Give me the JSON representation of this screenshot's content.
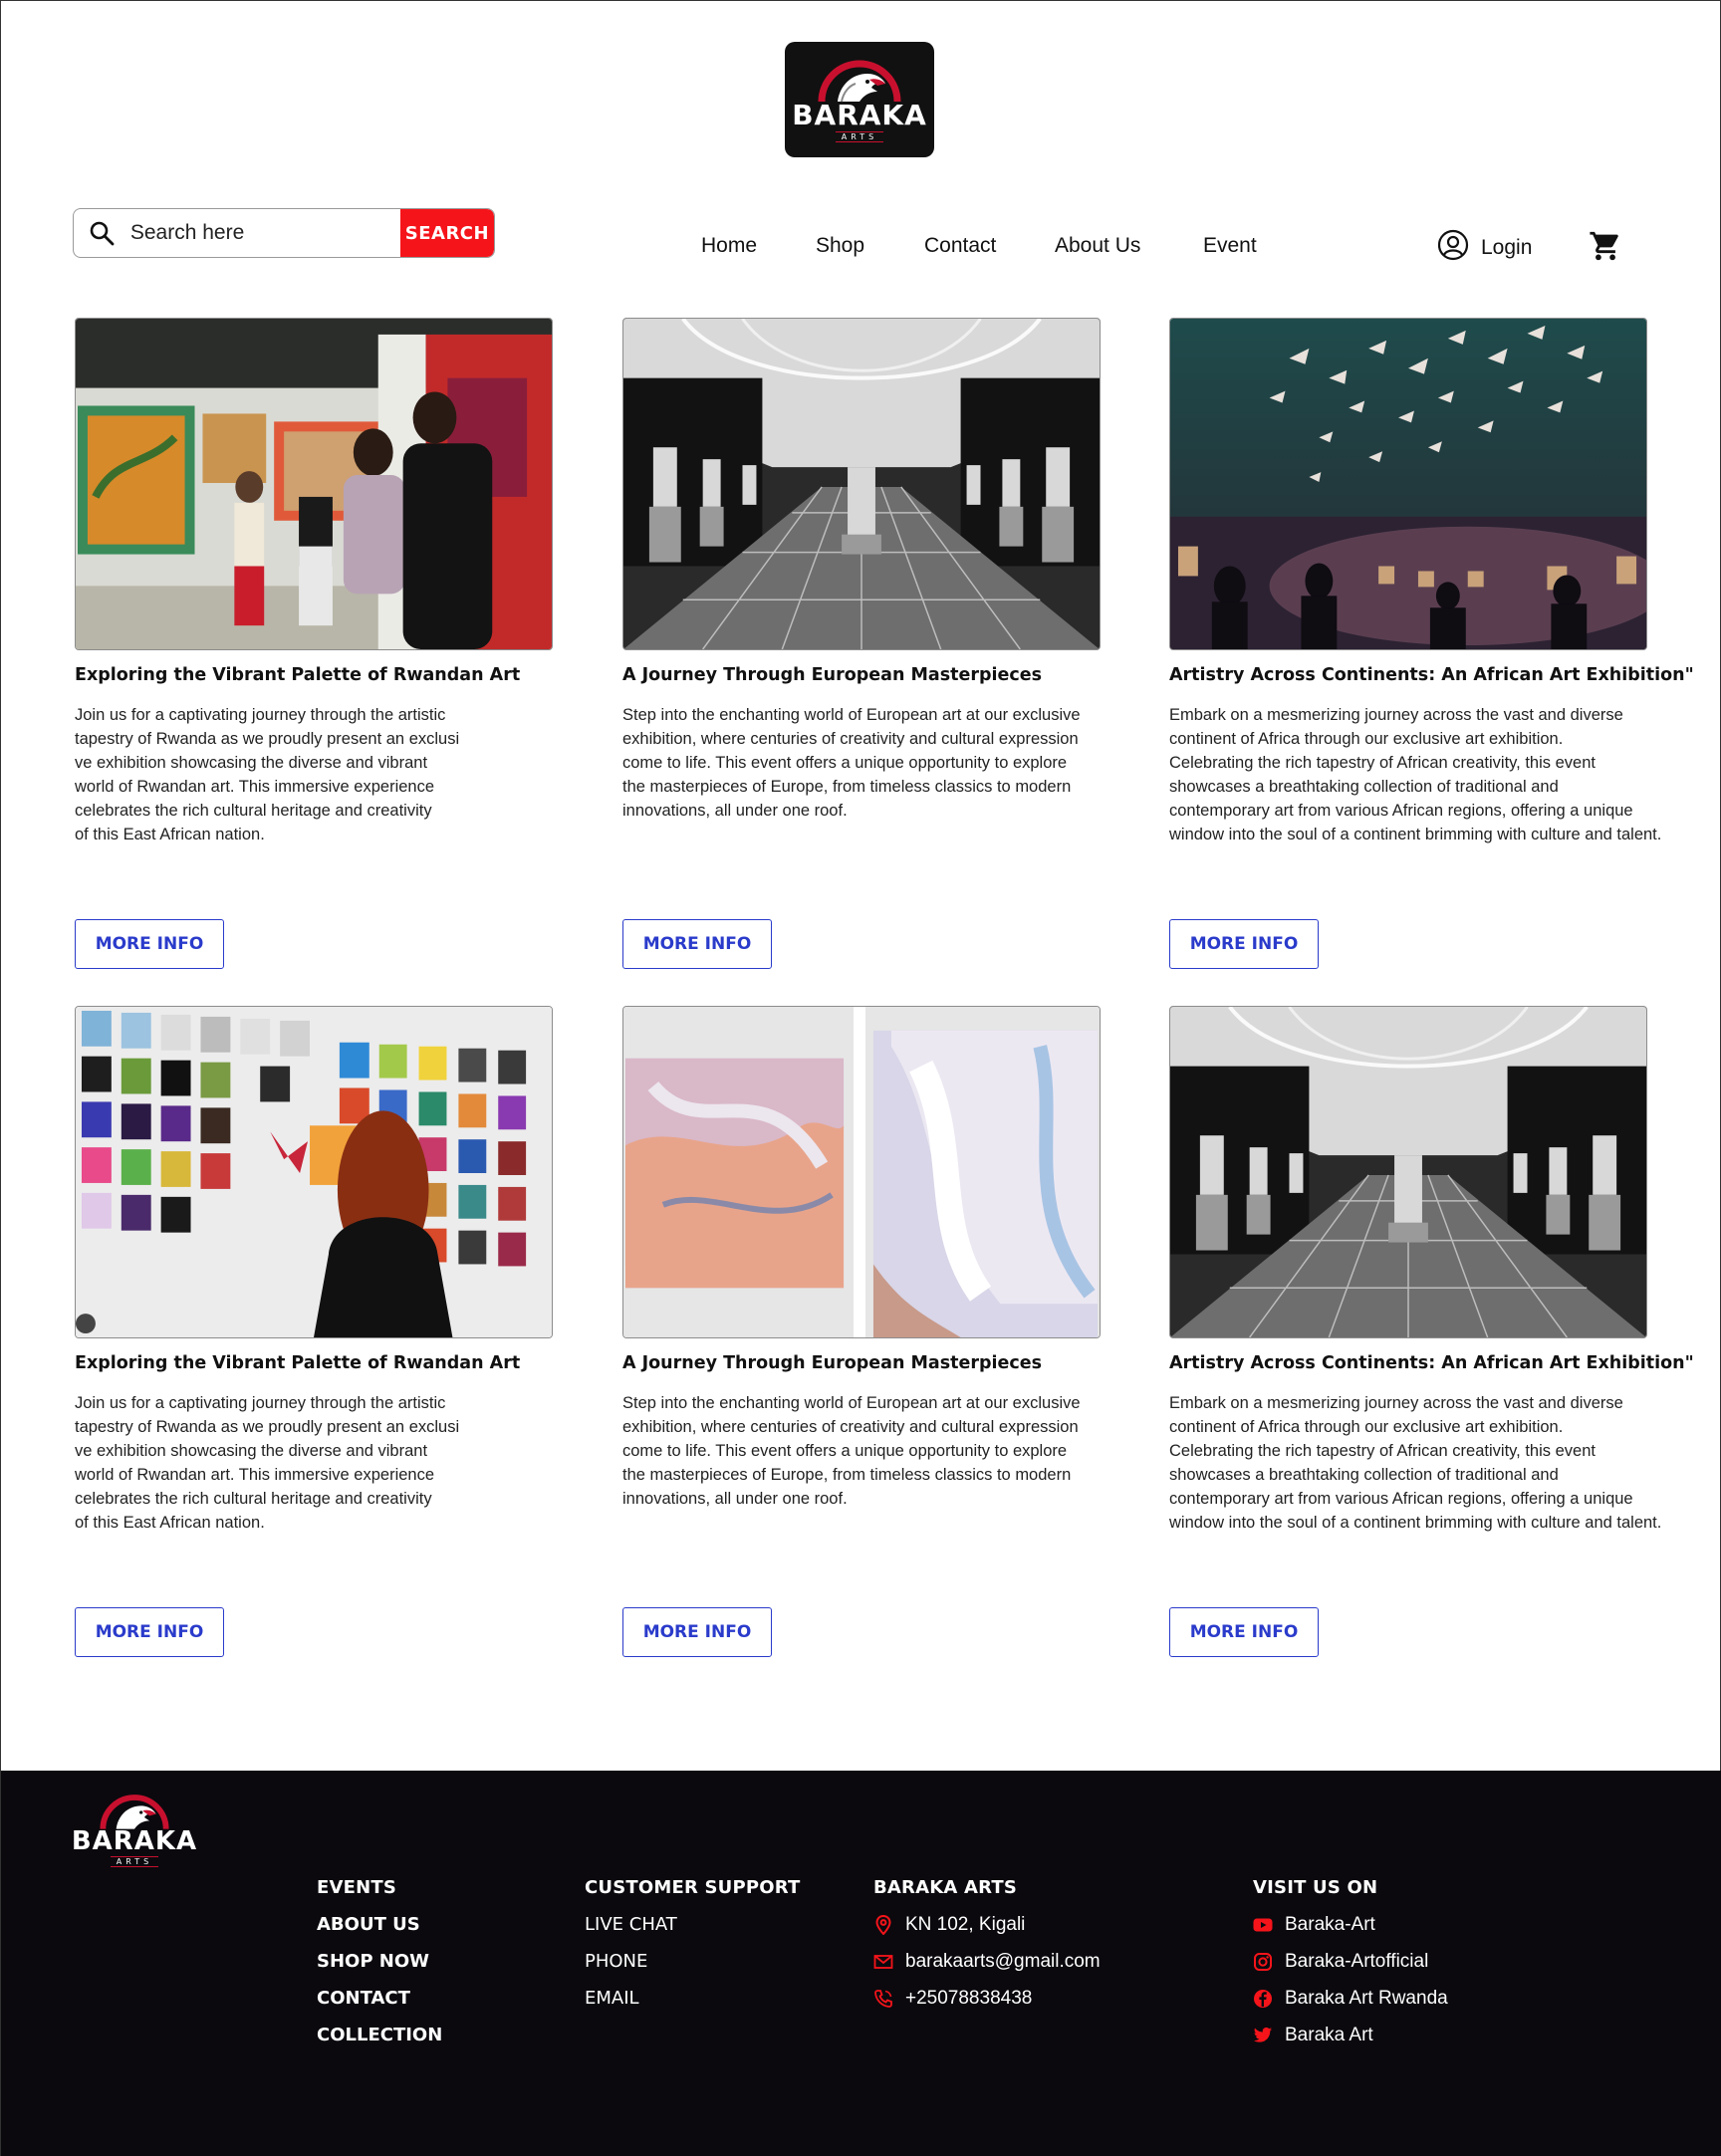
{
  "brand": {
    "name": "BARAKA",
    "sub": "ARTS"
  },
  "search": {
    "placeholder": "Search here",
    "button": "SEARCH"
  },
  "nav": {
    "home": "Home",
    "shop": "Shop",
    "contact": "Contact",
    "about": "About Us",
    "event": "Event"
  },
  "account": {
    "login": "Login"
  },
  "cards": [
    {
      "title": "Exploring the Vibrant Palette of Rwandan Art",
      "text": "Join us for a captivating journey through the artistic\ntapestry of Rwanda as we proudly present an exclusi\nve exhibition showcasing the diverse and vibrant\nworld of Rwandan art. This immersive experience\ncelebrates the rich cultural heritage and creativity\nof this East African nation.",
      "button": "MORE INFO"
    },
    {
      "title": "A Journey Through European Masterpieces",
      "text": "Step into the enchanting world of European art at our exclusive\n exhibition, where centuries of creativity and cultural expression\ncome to life. This event offers a unique opportunity to explore\n the masterpieces of Europe, from timeless classics to modern\ninnovations, all under one roof.",
      "button": "MORE INFO"
    },
    {
      "title": "Artistry Across Continents: An African Art Exhibition\"",
      "text": "Embark on a mesmerizing journey across the vast and diverse\ncontinent of Africa through our exclusive art exhibition.\nCelebrating the rich tapestry of African creativity, this event\nshowcases a breathtaking collection of traditional and\ncontemporary art from various African regions, offering a unique\nwindow into the soul of a continent brimming with culture and talent.",
      "button": "MORE INFO"
    },
    {
      "title": "Exploring the Vibrant Palette of Rwandan Art",
      "text": "Join us for a captivating journey through the artistic\ntapestry of Rwanda as we proudly present an exclusi\nve exhibition showcasing the diverse and vibrant\nworld of Rwandan art. This immersive experience\ncelebrates the rich cultural heritage and creativity\nof this East African nation.",
      "button": "MORE INFO"
    },
    {
      "title": "A Journey Through European Masterpieces",
      "text": "Step into the enchanting world of European art at our exclusive\n exhibition, where centuries of creativity and cultural expression\ncome to life. This event offers a unique opportunity to explore\n the masterpieces of Europe, from timeless classics to modern\ninnovations, all under one roof.",
      "button": "MORE INFO"
    },
    {
      "title": "Artistry Across Continents: An African Art Exhibition\"",
      "text": "Embark on a mesmerizing journey across the vast and diverse\ncontinent of Africa through our exclusive art exhibition.\nCelebrating the rich tapestry of African creativity, this event\nshowcases a breathtaking collection of traditional and\ncontemporary art from various African regions, offering a unique\nwindow into the soul of a continent brimming with culture and talent.",
      "button": "MORE INFO"
    }
  ],
  "footer": {
    "events": {
      "title": "EVENTS",
      "items": [
        "ABOUT US",
        "SHOP NOW",
        "CONTACT",
        "COLLECTION"
      ]
    },
    "support": {
      "title": "CUSTOMER SUPPORT",
      "items": [
        "LIVE CHAT",
        "PHONE",
        "EMAIL"
      ]
    },
    "baraka": {
      "title": "BARAKA ARTS",
      "address": "KN 102,  Kigali",
      "email": "barakaarts@gmail.com",
      "phone": "+25078838438"
    },
    "visit": {
      "title": "VISIT US ON",
      "youtube": "Baraka-Art",
      "instagram": "Baraka-Artofficial",
      "facebook": "Baraka Art Rwanda",
      "twitter": "Baraka Art"
    }
  },
  "colors": {
    "accent": "#f5141a",
    "link": "#2a3bcb",
    "footer_bg": "#0b090e"
  }
}
